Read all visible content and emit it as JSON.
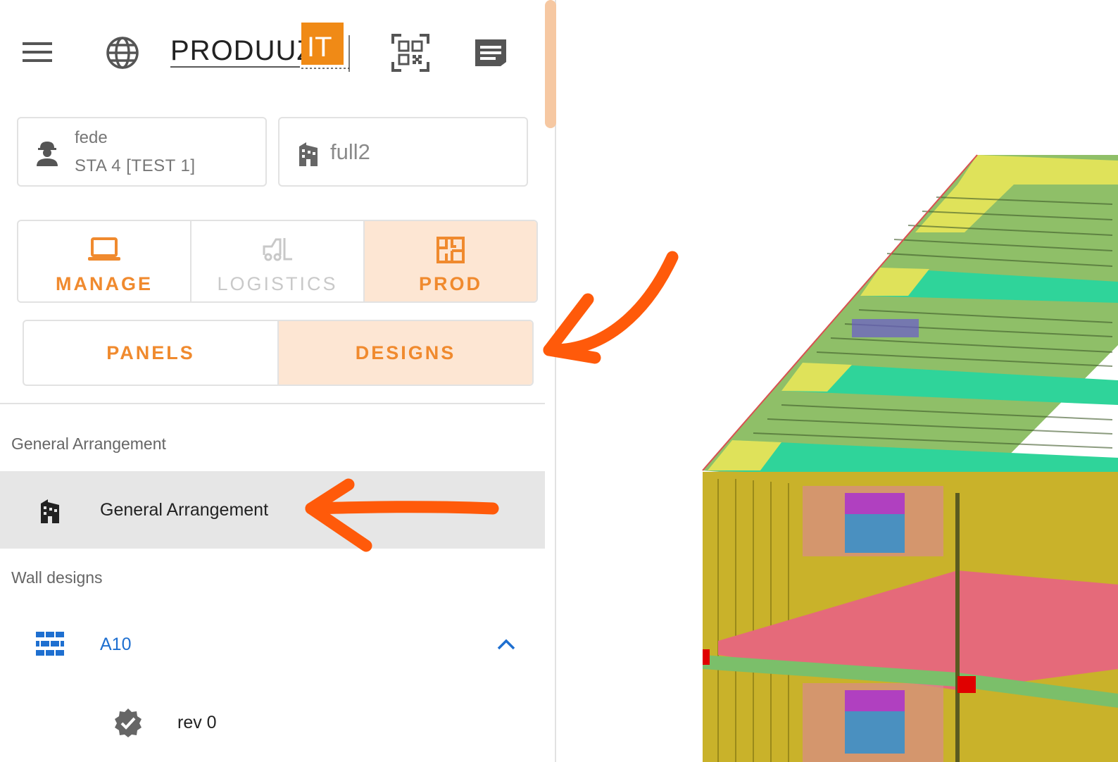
{
  "header": {
    "menu_icon": "hamburger-menu-icon",
    "language_icon": "globe-icon",
    "logo_text": "PRODUUZ",
    "logo_badge": "IT",
    "qr_icon": "qr-scan-icon",
    "notes_icon": "notes-icon"
  },
  "user": {
    "name": "fede",
    "station": "STA 4 [TEST 1]",
    "icon": "worker-icon"
  },
  "project": {
    "name": "full2",
    "icon": "building-icon"
  },
  "modes": [
    {
      "label": "MANAGE",
      "icon": "laptop-icon",
      "state": "enabled"
    },
    {
      "label": "LOGISTICS",
      "icon": "forklift-icon",
      "state": "disabled"
    },
    {
      "label": "PROD",
      "icon": "floor-plan-icon",
      "state": "active"
    }
  ],
  "subtabs": [
    {
      "label": "PANELS",
      "active": false
    },
    {
      "label": "DESIGNS",
      "active": true
    }
  ],
  "sections": {
    "general_arrangement_heading": "General Arrangement",
    "general_arrangement_item": "General Arrangement",
    "wall_designs_heading": "Wall designs",
    "wall_item": "A10",
    "revision": "rev 0"
  },
  "colors": {
    "accent": "#f08a2e",
    "accent_bg": "#fde6d3",
    "link_blue": "#1e6fd0",
    "annotation_arrow": "#ff5a0a"
  }
}
